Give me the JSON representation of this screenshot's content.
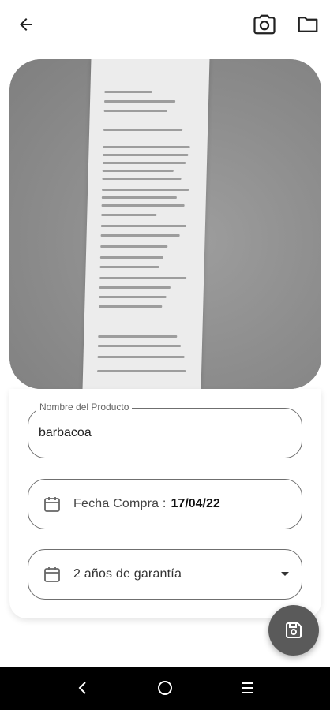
{
  "header": {
    "back_icon": "arrow-left-icon",
    "camera_icon": "camera-icon",
    "folder_icon": "folder-icon"
  },
  "photo": {
    "description_icon": "receipt-photo"
  },
  "form": {
    "product_name_label": "Nombre del Producto",
    "product_name_value": "barbacoa",
    "purchase_date_label": "Fecha Compra :",
    "purchase_date_value": "17/04/22",
    "warranty_value": "2 años de garantía",
    "calendar_icon": "calendar-icon",
    "dropdown_icon": "caret-down-icon"
  },
  "fab": {
    "save_icon": "floppy-disk-icon"
  },
  "navigation_bar": {
    "back_icon": "nav-back-icon",
    "home_icon": "nav-home-icon",
    "recents_icon": "nav-menu-icon"
  }
}
